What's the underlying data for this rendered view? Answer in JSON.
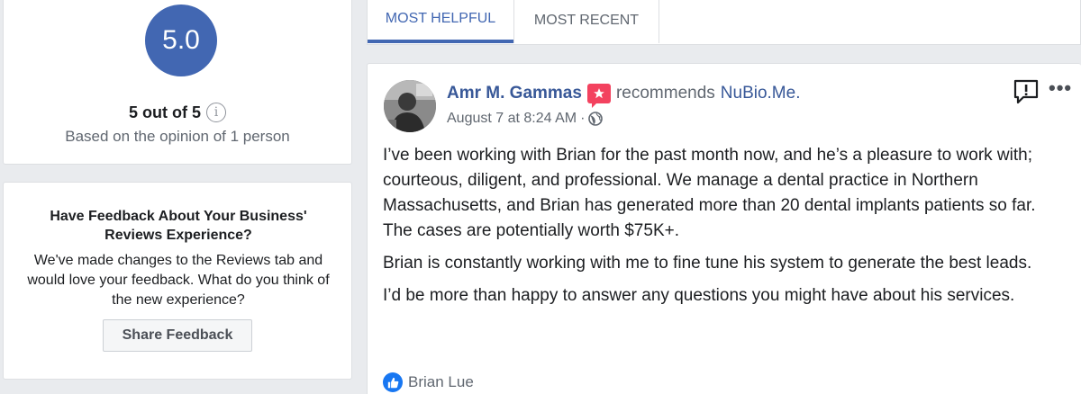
{
  "rating": {
    "score": "5.0",
    "summary": "5 out of 5",
    "info_glyph": "i",
    "based_on": "Based on the opinion of 1 person",
    "accent_color": "#4267b2"
  },
  "feedback": {
    "title": "Have Feedback About Your Business' Reviews Experience?",
    "body": "We've made changes to the Reviews tab and would love your feedback. What do you think of the new experience?",
    "button_label": "Share Feedback"
  },
  "tabs": [
    {
      "label": "MOST HELPFUL",
      "active": true
    },
    {
      "label": "MOST RECENT",
      "active": false
    }
  ],
  "review": {
    "reviewer_name": "Amr M. Gammas",
    "badge_icon": "recommend-badge-icon",
    "verb": "recommends",
    "page_name": "NuBio.Me.",
    "timestamp": "August 7 at 8:24 AM",
    "separator": "·",
    "privacy_icon": "globe-icon",
    "paragraphs": [
      "I’ve been working with Brian for the past month now, and he’s a pleasure to work with; courteous, diligent, and professional. We manage a dental practice in Northern Massachusetts, and Brian has generated more than 20 dental implants patients so far. The cases are potentially worth $75K+.",
      "Brian is constantly working with me to fine tune his system to generate the best leads.",
      "I’d be more than happy to answer any questions you might have about his services."
    ],
    "reaction_icon": "like-icon",
    "reaction_name": "Brian Lue"
  }
}
